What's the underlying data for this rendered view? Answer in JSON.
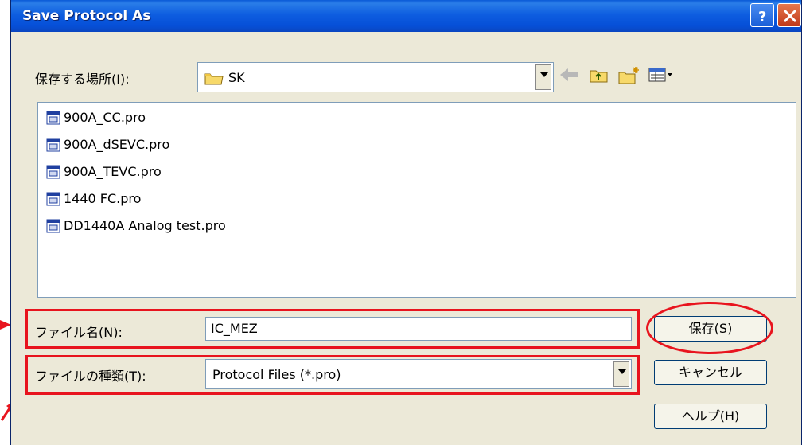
{
  "window": {
    "title": "Save Protocol As"
  },
  "location": {
    "label": "保存する場所(I):",
    "folder": "SK"
  },
  "files": [
    {
      "name": "900A_CC.pro"
    },
    {
      "name": "900A_dSEVC.pro"
    },
    {
      "name": "900A_TEVC.pro"
    },
    {
      "name": "1440 FC.pro"
    },
    {
      "name": "DD1440A Analog test.pro"
    }
  ],
  "filename": {
    "label": "ファイル名(N):",
    "value": "IC_MEZ"
  },
  "filetype": {
    "label": "ファイルの種類(T):",
    "value": "Protocol Files (*.pro)"
  },
  "buttons": {
    "save": "保存(S)",
    "cancel": "キャンセル",
    "help": "ヘルプ(H)"
  },
  "colors": {
    "highlight": "#e8141e",
    "titlebar": "#0a5ad7",
    "face": "#ece9d8"
  }
}
